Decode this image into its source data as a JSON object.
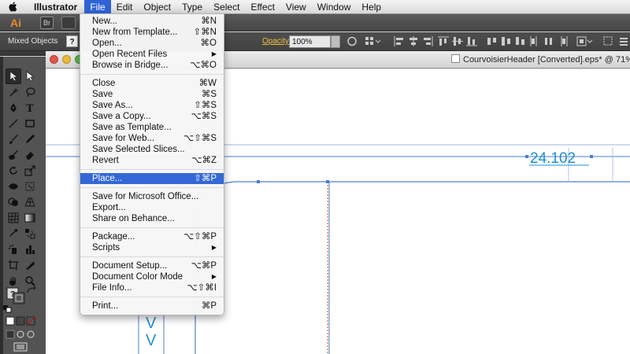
{
  "menubar": {
    "app_name": "Illustrator",
    "items": [
      "File",
      "Edit",
      "Object",
      "Type",
      "Select",
      "Effect",
      "View",
      "Window",
      "Help"
    ],
    "active": "File"
  },
  "appbar": {
    "logo": "Ai",
    "bridge_button": "Br"
  },
  "controlbar": {
    "selection_label": "Mixed Objects",
    "help_glyph": "?",
    "opacity_label": "Opacity:",
    "opacity_value": "100%"
  },
  "document": {
    "tab_title": "CourvoisierHeader [Converted].eps* @ 71% (",
    "measure_text": "24.102",
    "glyph_v1": "V",
    "glyph_v2": "V"
  },
  "file_menu": {
    "groups": [
      [
        {
          "label": "New...",
          "shortcut": "⌘N"
        },
        {
          "label": "New from Template...",
          "shortcut": "⇧⌘N"
        },
        {
          "label": "Open...",
          "shortcut": "⌘O"
        },
        {
          "label": "Open Recent Files",
          "submenu": true
        },
        {
          "label": "Browse in Bridge...",
          "shortcut": "⌥⌘O"
        }
      ],
      [
        {
          "label": "Close",
          "shortcut": "⌘W"
        },
        {
          "label": "Save",
          "shortcut": "⌘S"
        },
        {
          "label": "Save As...",
          "shortcut": "⇧⌘S"
        },
        {
          "label": "Save a Copy...",
          "shortcut": "⌥⌘S"
        },
        {
          "label": "Save as Template..."
        },
        {
          "label": "Save for Web...",
          "shortcut": "⌥⇧⌘S"
        },
        {
          "label": "Save Selected Slices..."
        },
        {
          "label": "Revert",
          "shortcut": "⌥⌘Z"
        }
      ],
      [
        {
          "label": "Place...",
          "shortcut": "⇧⌘P",
          "highlighted": true
        }
      ],
      [
        {
          "label": "Save for Microsoft Office..."
        },
        {
          "label": "Export..."
        },
        {
          "label": "Share on Behance..."
        }
      ],
      [
        {
          "label": "Package...",
          "shortcut": "⌥⇧⌘P"
        },
        {
          "label": "Scripts",
          "submenu": true
        }
      ],
      [
        {
          "label": "Document Setup...",
          "shortcut": "⌥⌘P"
        },
        {
          "label": "Document Color Mode",
          "submenu": true
        },
        {
          "label": "File Info...",
          "shortcut": "⌥⇧⌘I"
        }
      ],
      [
        {
          "label": "Print...",
          "shortcut": "⌘P"
        }
      ]
    ]
  },
  "colors": {
    "menu_highlight": "#3468d6",
    "guide_blue": "#4a7fd1",
    "measure_blue": "#1d8fd4",
    "ai_orange": "#e68a2e"
  }
}
